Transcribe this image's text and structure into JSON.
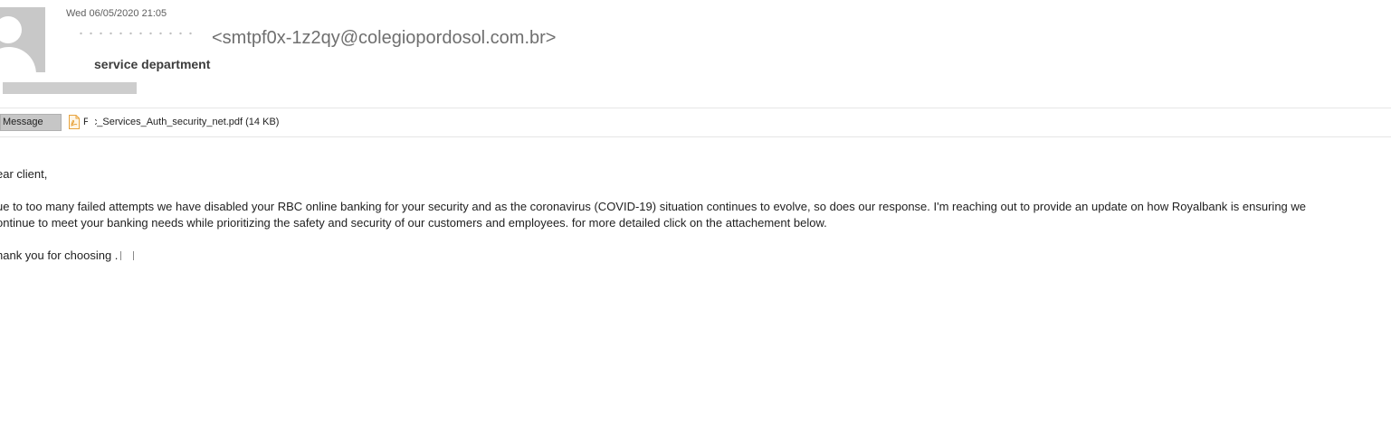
{
  "header": {
    "timestamp": "Wed 06/05/2020 21:05",
    "sender_email": "<smtpf0x-1z2qy@colegiopordosol.com.br>",
    "subject": "service department"
  },
  "attachments": {
    "message_tab_label": "Message",
    "items": [
      {
        "name": "F  c_Services_Auth_security_net.pdf (14 KB)",
        "icon": "pdf-file-icon"
      }
    ]
  },
  "body": {
    "greeting": "ear client,",
    "paragraph_line_1": "ue to too many failed attempts we have disabled your RBC online banking for your security and as the coronavirus (COVID-19) situation continues to evolve, so does our response. I'm reaching out to provide an update on how Royalbank is ensuring we",
    "paragraph_line_2": "ontinue to meet your banking needs while prioritizing the safety and security of our customers and employees. for more detailed click on the attachement below.",
    "closing": "hank you for choosing    ."
  },
  "colors": {
    "text": "#1f1f1f",
    "muted": "#6f6f6f",
    "redaction": "#cdcdcd",
    "pdf_icon": "#e8a33d"
  }
}
